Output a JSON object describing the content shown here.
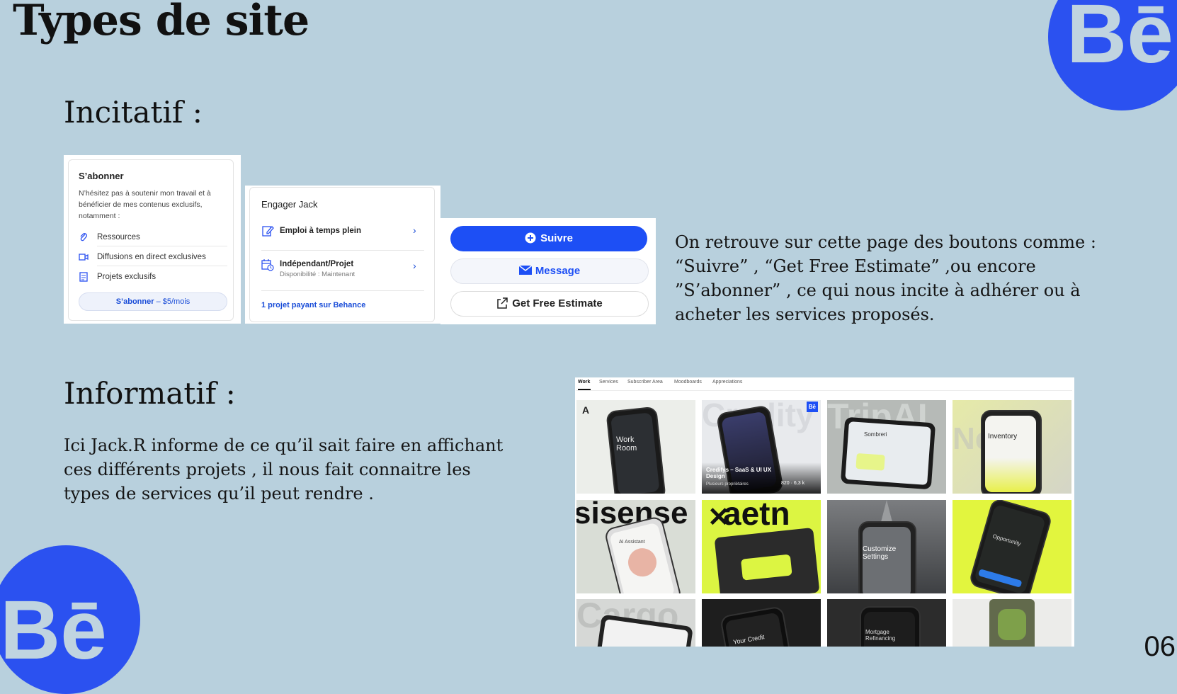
{
  "page": {
    "title": "Types de site",
    "page_number": "06"
  },
  "incitatif": {
    "heading": "Incitatif :",
    "description": "On retrouve sur cette page des boutons comme : “Suivre” , “Get Free Estimate” ,ou encore ”S’abonner” , ce qui nous incite à adhérer ou à acheter les services proposés."
  },
  "subscribe_card": {
    "title": "S’abonner",
    "text": "N’hésitez pas à soutenir mon travail et à bénéficier de mes contenus exclusifs, notamment :",
    "items": [
      {
        "label": "Ressources",
        "icon": "paperclip-icon"
      },
      {
        "label": "Diffusions en direct exclusives",
        "icon": "video-icon"
      },
      {
        "label": "Projets exclusifs",
        "icon": "document-icon"
      }
    ],
    "button_label": "S’abonner",
    "button_price": "– $5/mois"
  },
  "hire_card": {
    "title": "Engager Jack",
    "options": [
      {
        "label": "Emploi à temps plein",
        "sub": "",
        "icon": "pencil-icon"
      },
      {
        "label": "Indépendant/Projet",
        "sub": "Disponibilité : Maintenant",
        "icon": "calendar-clock-icon"
      }
    ],
    "footer_link": "1 projet payant sur Behance"
  },
  "action_buttons": {
    "follow": "Suivre",
    "message": "Message",
    "estimate": "Get Free Estimate"
  },
  "informatif": {
    "heading": "Informatif :",
    "description": "Ici Jack.R informe de ce qu’il sait faire en affichant ces différents projets , il nous fait connaitre les types de services qu’il peut rendre ."
  },
  "gallery": {
    "tabs": [
      "Work",
      "Services",
      "Subscriber Area",
      "Moodboards",
      "Appreciations"
    ],
    "active_tab": "Work",
    "tiles": [
      {
        "big": "",
        "label": "Work Room"
      },
      {
        "big": "Credity",
        "label": "Credifys – SaaS & UI UX Design",
        "sub": "Plusieurs propriétaires",
        "stats": "820 · 6,3 k",
        "badge": "Bē"
      },
      {
        "big": "TripAI",
        "label": "Sombreri"
      },
      {
        "big": "Ne ite",
        "label": "Inventory"
      },
      {
        "big": "sisense",
        "label": "AI Assistant"
      },
      {
        "big": "aetn",
        "label": ""
      },
      {
        "big": "",
        "label": "Customize Settings"
      },
      {
        "big": "",
        "label": "Opportunity"
      },
      {
        "big": "Cargo",
        "label": ""
      },
      {
        "big": "",
        "label": "Your Credit"
      },
      {
        "big": "",
        "label": "Mortgage Refinancing"
      },
      {
        "big": "",
        "label": ""
      }
    ]
  },
  "brand": {
    "logo_text": "Bē",
    "accent": "#2b51f0",
    "background": "#b8d0dd"
  }
}
